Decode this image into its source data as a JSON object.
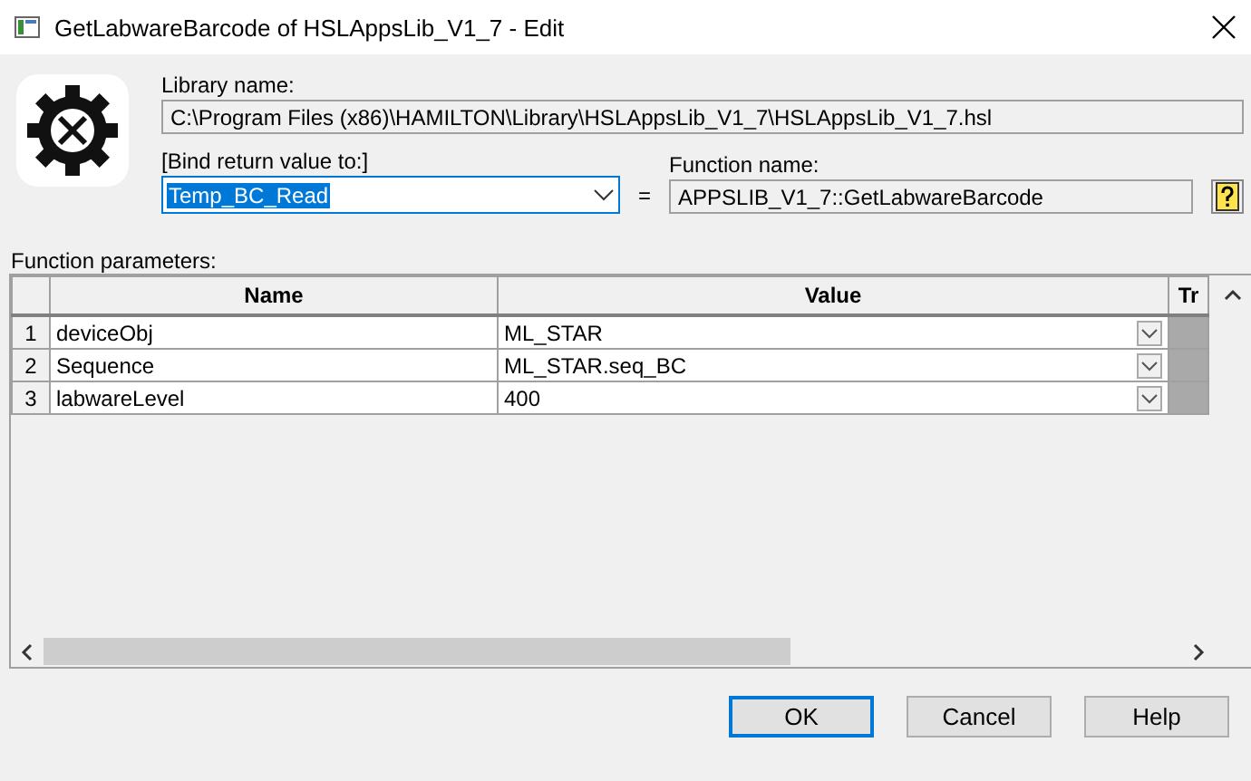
{
  "window": {
    "title": "GetLabwareBarcode of HSLAppsLib_V1_7 - Edit"
  },
  "library": {
    "label": "Library name:",
    "value": "C:\\Program Files (x86)\\HAMILTON\\Library\\HSLAppsLib_V1_7\\HSLAppsLib_V1_7.hsl"
  },
  "bind": {
    "label": "[Bind return value to:]",
    "value": "Temp_BC_Read",
    "text_selected": true
  },
  "equals": "=",
  "function": {
    "label": "Function name:",
    "value": "APPSLIB_V1_7::GetLabwareBarcode"
  },
  "parameters": {
    "label": "Function parameters:",
    "columns": [
      "Name",
      "Value",
      "Tr"
    ],
    "rows": [
      {
        "index": "1",
        "name": "deviceObj",
        "value": "ML_STAR"
      },
      {
        "index": "2",
        "name": "Sequence",
        "value": "ML_STAR.seq_BC"
      },
      {
        "index": "3",
        "name": "labwareLevel",
        "value": "400"
      }
    ]
  },
  "buttons": [
    {
      "label": "OK",
      "default": true
    },
    {
      "label": "Cancel",
      "default": false
    },
    {
      "label": "Help",
      "default": false
    }
  ]
}
